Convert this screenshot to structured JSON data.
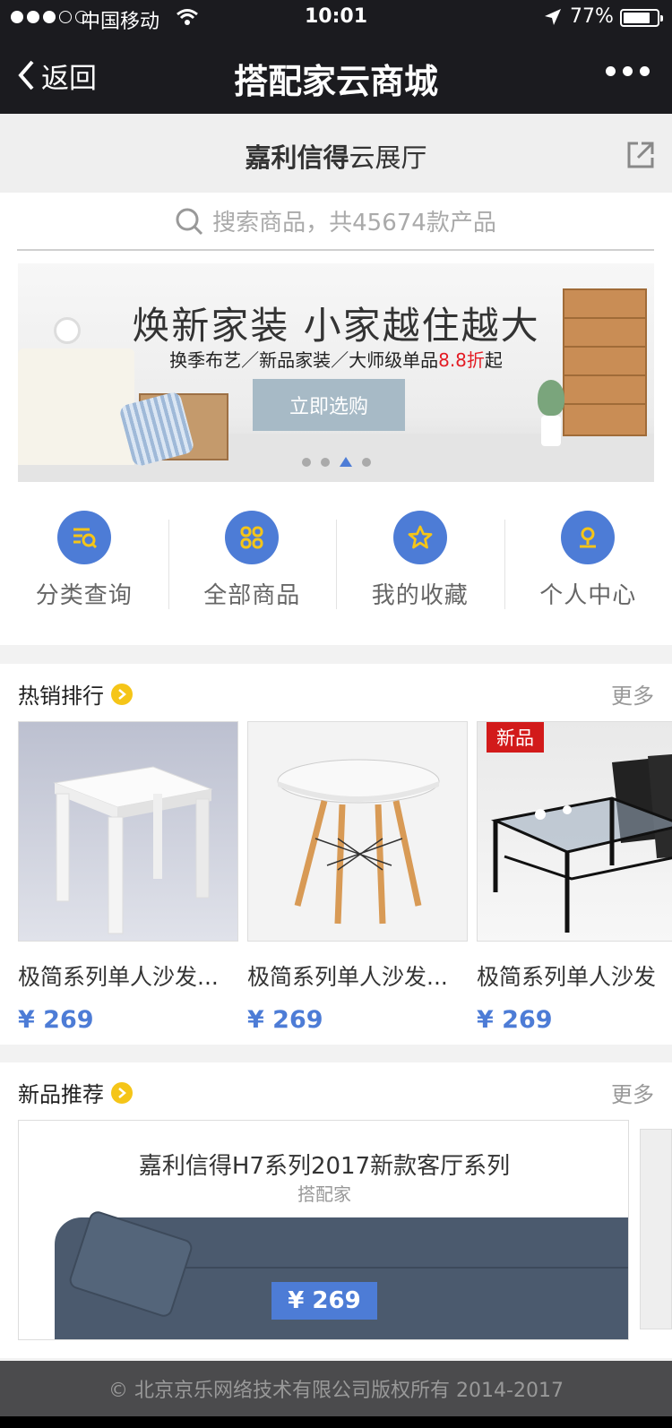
{
  "status_bar": {
    "carrier": "中国移动",
    "time": "10:01",
    "battery": "77%"
  },
  "nav": {
    "back_label": "返回",
    "title": "搭配家云商城"
  },
  "store": {
    "name_bold": "嘉利信得",
    "name_rest": "云展厅"
  },
  "search": {
    "placeholder": "搜索商品，共45674款产品"
  },
  "banner": {
    "headline": "焕新家装 小家越住越大",
    "subtitle_before": "换季布艺／新品家装／大师级单品",
    "subtitle_discount": "8.8折",
    "subtitle_after": "起",
    "cta": "立即选购",
    "slide_count": 4,
    "active_slide": 3
  },
  "quick_nav": [
    {
      "label": "分类查询",
      "icon": "category-search-icon"
    },
    {
      "label": "全部商品",
      "icon": "grid-icon"
    },
    {
      "label": "我的收藏",
      "icon": "star-icon"
    },
    {
      "label": "个人中心",
      "icon": "user-icon"
    }
  ],
  "hot": {
    "title": "热销排行",
    "more": "更多",
    "products": [
      {
        "name": "极简系列单人沙发...",
        "price": "¥ 269",
        "badge": ""
      },
      {
        "name": "极简系列单人沙发...",
        "price": "¥ 269",
        "badge": ""
      },
      {
        "name": "极简系列单人沙发",
        "price": "¥ 269",
        "badge": "新品"
      }
    ]
  },
  "new": {
    "title": "新品推荐",
    "more": "更多",
    "feature": {
      "title": "嘉利信得H7系列2017新款客厅系列",
      "brand": "搭配家",
      "price": "¥ 269"
    }
  },
  "footer": {
    "copyright": "© 北京京乐网络技术有限公司版权所有 2014-2017"
  },
  "colors": {
    "accent": "#4d7cd6",
    "badge_red": "#d21a1a",
    "arrow_yellow": "#f5c518",
    "topbar": "#1b1b1f"
  }
}
